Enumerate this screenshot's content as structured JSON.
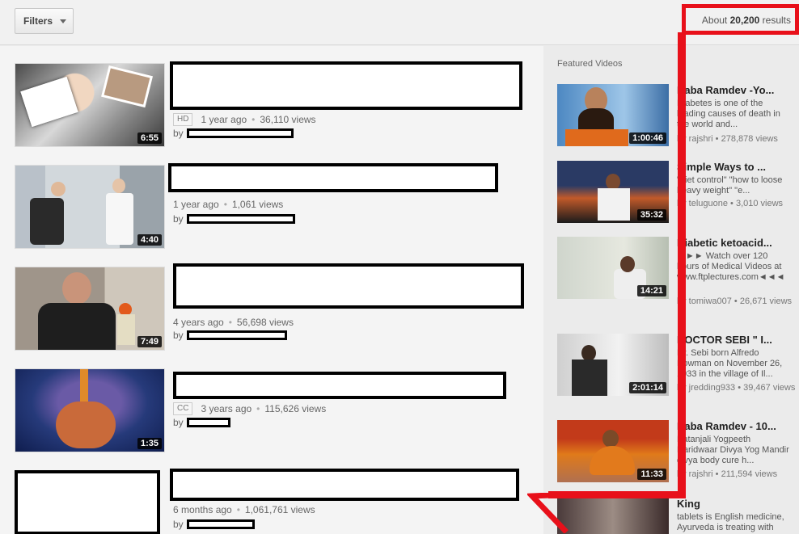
{
  "toolbar": {
    "filters_label": "Filters",
    "results_prefix": "About ",
    "results_count": "20,200",
    "results_suffix": " results"
  },
  "results": [
    {
      "duration": "6:55",
      "badge": "HD",
      "age": "1 year ago",
      "views": "36,110 views",
      "by": "by"
    },
    {
      "duration": "4:40",
      "badge": "",
      "age": "1 year ago",
      "views": "1,061 views",
      "by": "by"
    },
    {
      "duration": "7:49",
      "badge": "",
      "age": "4 years ago",
      "views": "56,698 views",
      "by": "by"
    },
    {
      "duration": "1:35",
      "badge": "CC",
      "age": "3 years ago",
      "views": "115,626 views",
      "by": "by"
    },
    {
      "duration": "",
      "badge": "",
      "age": "6 months ago",
      "views": "1,061,761 views",
      "by": "by"
    }
  ],
  "sidebar": {
    "heading": "Featured Videos",
    "items": [
      {
        "title": "Baba Ramdev -Yo...",
        "desc": "Diabetes is one of the leading causes of death in the world and...",
        "channel": "by rajshri",
        "views": "278,878 views",
        "duration": "1:00:46"
      },
      {
        "title": "Simple Ways to ...",
        "desc": "\"diet control\" \"how to loose heavy weight\" \"e...",
        "channel": "by teluguone",
        "views": "3,010 views",
        "duration": "35:32"
      },
      {
        "title": "Diabetic ketoacid...",
        "desc": "►►► Watch over 120 hours of Medical Videos at www.ftplectures.com◄◄◄",
        "channel": "by tomiwa007",
        "views": "26,671 views",
        "duration": "14:21"
      },
      {
        "title": "DOCTOR SEBI \" I...",
        "desc": "Dr. Sebi born Alfredo Bowman on November 26, 1933 in the village of Il...",
        "channel": "by jredding933",
        "views": "39,467 views",
        "duration": "2:01:14"
      },
      {
        "title": "Baba Ramdev - 10...",
        "desc": "Patanjali Yogpeeth Haridwaar Divya Yog Mandir divya body cure h...",
        "channel": "by rajshri",
        "views": "211,594 views",
        "duration": "11:33"
      },
      {
        "title": "King",
        "desc": "tablets is English medicine, Ayurveda is treating with",
        "channel": "",
        "views": "",
        "duration": ""
      }
    ]
  },
  "colors": {
    "annotation": "#e8101a",
    "redaction": "#000000"
  }
}
